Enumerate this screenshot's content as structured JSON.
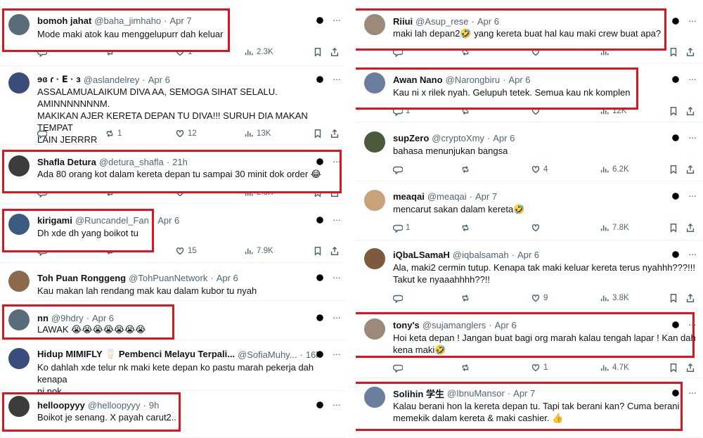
{
  "colors": {
    "highlight": "#e0141e",
    "text": "#0f1419",
    "muted": "#536471"
  },
  "icons": [
    "reply-icon",
    "retweet-icon",
    "like-icon",
    "views-icon",
    "bookmark-icon",
    "share-icon",
    "grok-icon",
    "more-icon"
  ],
  "left": [
    {
      "name": "bomoh jahat",
      "handle": "@baha_jimhaho",
      "time": "Apr 7",
      "text": "Mode maki atok kau menggelupurr dah keluar",
      "replies": "",
      "retweets": "",
      "likes": "1",
      "views": "2.3K"
    },
    {
      "name": "ɘɞ ɾ · ⴹ · ɜ",
      "handle": "@aslandelrey",
      "time": "Apr 6",
      "text": "ASSALAMUALAIKUM DIVA AA, SEMOGA SIHAT SELALU. AMINNNNNNNM.\nMAKIKAN AJER KERETA DEPAN TU DIVA!!! SURUH DIA MAKAN TEMPAT\nLAIN JERRRR",
      "replies": "",
      "retweets": "1",
      "likes": "12",
      "views": "13K"
    },
    {
      "name": "Shafla Detura",
      "handle": "@detura_shafla",
      "time": "21h",
      "text": "Ada 80 orang kot dalam kereta depan tu sampai 30 minit dok order 😂",
      "replies": "",
      "retweets": "",
      "likes": "",
      "views": "2.3K"
    },
    {
      "name": "kirigami",
      "handle": "@Runcandel_Fan",
      "time": "Apr 6",
      "text": "Dh xde dh yang boikot tu",
      "replies": "",
      "retweets": "",
      "likes": "15",
      "views": "7.9K"
    },
    {
      "name": "Toh Puan Ronggeng",
      "handle": "@TohPuanNetwork",
      "time": "Apr 6",
      "text": "Kau makan lah rendang mak kau dalam kubor tu nyah",
      "replies": "",
      "retweets": "",
      "likes": "",
      "views": ""
    },
    {
      "name": "nn",
      "handle": "@9hdry",
      "time": "Apr 6",
      "text": "LAWAK 😭😭😭😭😭😭😭",
      "replies": "",
      "retweets": "",
      "likes": "",
      "views": ""
    },
    {
      "name": "Hidup MIMIFLY 🥛 Pembenci Melayu Terpali...",
      "handle": "@SofiaMuhy...",
      "time": "16h",
      "text": "Ko dahlah xde telur nk maki kete depan ko pastu marah pekerja dah kenapa\nni nok",
      "replies": "",
      "retweets": "",
      "likes": "",
      "views": ""
    },
    {
      "name": "helloopyyy",
      "handle": "@helloopyyy",
      "time": "9h",
      "text": "Boikot je senang. X payah carut2..",
      "replies": "",
      "retweets": "",
      "likes": "",
      "views": ""
    }
  ],
  "right": [
    {
      "name": "Riiui",
      "handle": "@Asup_rese",
      "time": "Apr 6",
      "text": "maki lah depan2🤣 yang kereta buat hal kau maki crew buat apa?",
      "replies": "",
      "retweets": "",
      "likes": "",
      "views": ""
    },
    {
      "name": "Awan Nano",
      "handle": "@Narongbiru",
      "time": "Apr 6",
      "text": "Kau ni x rilek nyah. Gelupuh tetek. Semua kau nk komplen",
      "replies": "1",
      "retweets": "",
      "likes": "",
      "views": "12K"
    },
    {
      "name": "supZero",
      "handle": "@cryptoXmy",
      "time": "Apr 6",
      "text": "bahasa menunjukan bangsa",
      "replies": "",
      "retweets": "",
      "likes": "4",
      "views": "6.2K"
    },
    {
      "name": "meaqai",
      "handle": "@meaqai",
      "time": "Apr 7",
      "text": "mencarut sakan dalam kereta🤣",
      "replies": "1",
      "retweets": "",
      "likes": "",
      "views": "7.8K"
    },
    {
      "name": "iQbaLSamaH",
      "handle": "@iqbalsamah",
      "time": "Apr 6",
      "text": "Ala, maki2 cermin tutup. Kenapa tak maki keluar kereta terus nyahhh???!!!\nTakut ke nyaaahhhh??!!",
      "replies": "",
      "retweets": "",
      "likes": "9",
      "views": "3.8K"
    },
    {
      "name": "tony's",
      "handle": "@sujamanglers",
      "time": "Apr 6",
      "text": "Hoi keta depan ! Jangan buat bagi org marah kalau tengah lapar ! Kan dah\nkena maki🤣",
      "replies": "",
      "retweets": "",
      "likes": "1",
      "views": "4.7K"
    },
    {
      "name": "Solihin 学生",
      "handle": "@IbnuMansor",
      "time": "Apr 7",
      "text": "Kalau berani hon la kereta depan tu. Tapi tak berani kan? Cuma berani\nmemekik dalam kereta & maki cashier. 👍",
      "replies": "",
      "retweets": "",
      "likes": "",
      "views": ""
    }
  ]
}
